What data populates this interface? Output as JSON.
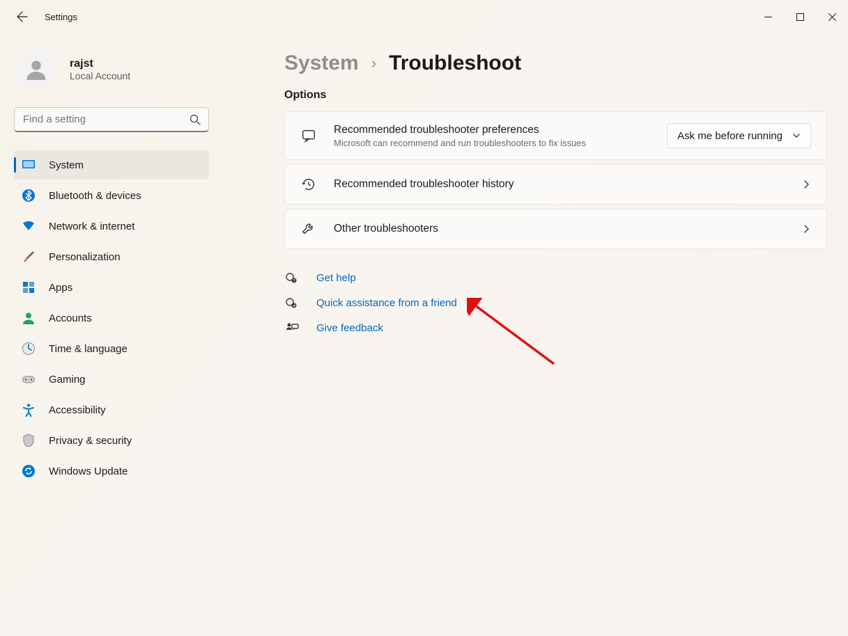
{
  "window": {
    "app_title": "Settings"
  },
  "profile": {
    "name": "rajst",
    "account_type": "Local Account"
  },
  "search": {
    "placeholder": "Find a setting"
  },
  "sidebar": {
    "items": [
      {
        "label": "System",
        "selected": true
      },
      {
        "label": "Bluetooth & devices",
        "selected": false
      },
      {
        "label": "Network & internet",
        "selected": false
      },
      {
        "label": "Personalization",
        "selected": false
      },
      {
        "label": "Apps",
        "selected": false
      },
      {
        "label": "Accounts",
        "selected": false
      },
      {
        "label": "Time & language",
        "selected": false
      },
      {
        "label": "Gaming",
        "selected": false
      },
      {
        "label": "Accessibility",
        "selected": false
      },
      {
        "label": "Privacy & security",
        "selected": false
      },
      {
        "label": "Windows Update",
        "selected": false
      }
    ]
  },
  "breadcrumb": {
    "parent": "System",
    "current": "Troubleshoot"
  },
  "options": {
    "section_title": "Options",
    "preferences": {
      "title": "Recommended troubleshooter preferences",
      "subtitle": "Microsoft can recommend and run troubleshooters to fix issues",
      "dropdown_value": "Ask me before running"
    },
    "history": {
      "title": "Recommended troubleshooter history"
    },
    "other": {
      "title": "Other troubleshooters"
    }
  },
  "help": {
    "get_help": "Get help",
    "quick_assist": "Quick assistance from a friend",
    "feedback": "Give feedback"
  }
}
